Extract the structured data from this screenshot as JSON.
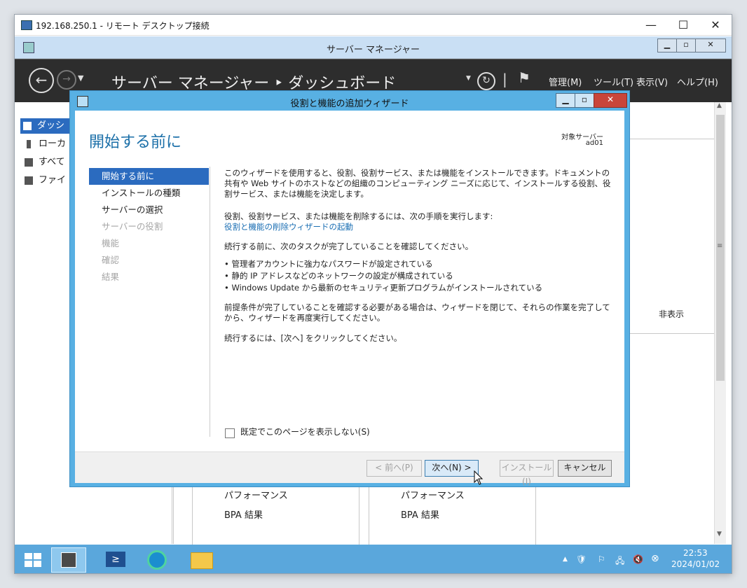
{
  "rdp": {
    "title": "192.168.250.1 - リモート デスクトップ接続",
    "minimize": "—",
    "maximize": "☐",
    "close": "✕"
  },
  "server_manager": {
    "window_title": "サーバー マネージャー",
    "breadcrumb": "サーバー マネージャー ‣ ダッシュボード",
    "menus": [
      "管理(M)",
      "ツール(T)",
      "表示(V)",
      "ヘルプ(H)"
    ],
    "sidebar": [
      "ダッシ",
      "ローカ",
      "すべて",
      "ファイ"
    ],
    "hide_label": "非表示",
    "tiles": [
      {
        "perf": "パフォーマンス",
        "bpa": "BPA 結果"
      },
      {
        "perf": "パフォーマンス",
        "bpa": "BPA 結果"
      }
    ]
  },
  "wizard": {
    "title": "役割と機能の追加ウィザード",
    "heading": "開始する前に",
    "target_label": "対象サーバー",
    "target_value": "ad01",
    "steps": [
      {
        "label": "開始する前に",
        "state": "active"
      },
      {
        "label": "インストールの種類",
        "state": "normal"
      },
      {
        "label": "サーバーの選択",
        "state": "normal"
      },
      {
        "label": "サーバーの役割",
        "state": "disabled"
      },
      {
        "label": "機能",
        "state": "disabled"
      },
      {
        "label": "確認",
        "state": "disabled"
      },
      {
        "label": "結果",
        "state": "disabled"
      }
    ],
    "intro": "このウィザードを使用すると、役割、役割サービス、または機能をインストールできます。ドキュメントの共有や Web サイトのホストなどの組織のコンピューティング ニーズに応じて、インストールする役割、役割サービス、または機能を決定します。",
    "remove_text": "役割、役割サービス、または機能を削除するには、次の手順を実行します:",
    "remove_link": "役割と機能の削除ウィザードの起動",
    "confirm_text": "続行する前に、次のタスクが完了していることを確認してください。",
    "bullets": [
      "管理者アカウントに強力なパスワードが設定されている",
      "静的 IP アドレスなどのネットワークの設定が構成されている",
      "Windows Update から最新のセキュリティ更新プログラムがインストールされている"
    ],
    "prereq_text": "前提条件が完了していることを確認する必要がある場合は、ウィザードを閉じて、それらの作業を完了してから、ウィザードを再度実行してください。",
    "continue_text": "続行するには、[次へ] をクリックしてください。",
    "skip_checkbox": "既定でこのページを表示しない(S)",
    "buttons": {
      "prev": "< 前へ(P)",
      "next": "次へ(N) >",
      "install": "インストール(I)",
      "cancel": "キャンセル"
    }
  },
  "taskbar": {
    "time": "22:53",
    "date": "2024/01/02"
  },
  "colors": {
    "accent": "#2b6bbf",
    "wizard_frame": "#58b0e3",
    "taskbar": "#5aa7dc",
    "header_dark": "#2d2d2d",
    "close_red": "#c9453a"
  }
}
